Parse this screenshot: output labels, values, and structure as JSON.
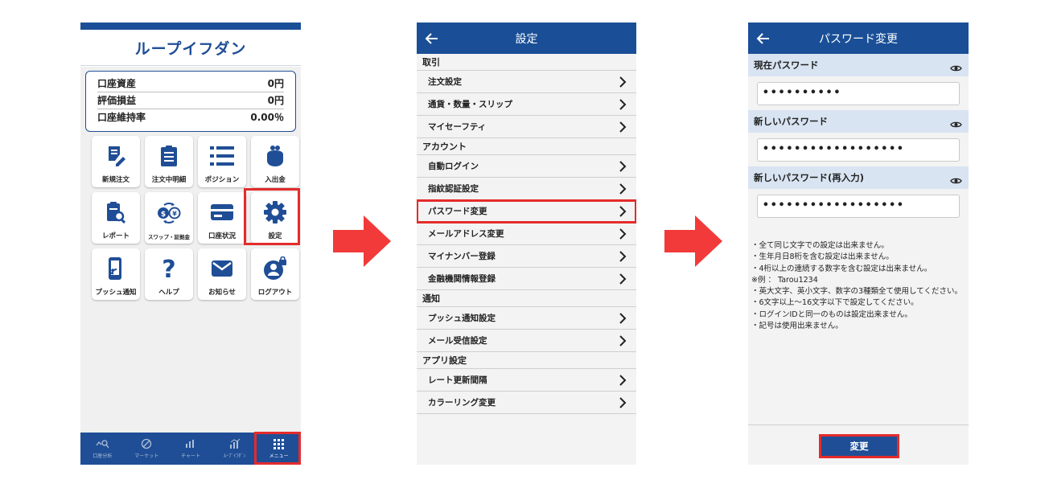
{
  "screen1": {
    "brand": "ループイフダン",
    "account": [
      {
        "label": "口座資産",
        "value": "0円"
      },
      {
        "label": "評価損益",
        "value": "0円"
      },
      {
        "label": "口座維持率",
        "value": "0.00％"
      }
    ],
    "tiles": [
      {
        "label": "新規注文",
        "icon": "new-order-icon"
      },
      {
        "label": "注文中明細",
        "icon": "order-details-icon"
      },
      {
        "label": "ポジション",
        "icon": "position-list-icon"
      },
      {
        "label": "入出金",
        "icon": "purse-icon"
      },
      {
        "label": "レポート",
        "icon": "report-icon"
      },
      {
        "label": "スワップ・証拠金",
        "icon": "swap-icon"
      },
      {
        "label": "口座状況",
        "icon": "card-icon"
      },
      {
        "label": "設定",
        "icon": "gear-icon"
      },
      {
        "label": "プッシュ通知",
        "icon": "phone-notify-icon"
      },
      {
        "label": "ヘルプ",
        "icon": "help-icon"
      },
      {
        "label": "お知らせ",
        "icon": "mail-icon"
      },
      {
        "label": "ログアウト",
        "icon": "logout-icon"
      }
    ],
    "tabs": [
      {
        "label": "口座分析",
        "icon": "analysis-icon"
      },
      {
        "label": "マーケット",
        "icon": "market-icon"
      },
      {
        "label": "チャート",
        "icon": "chart-icon"
      },
      {
        "label": "ﾙｰﾌﾟｲﾌﾀﾞﾝ",
        "icon": "loop-icon"
      },
      {
        "label": "メニュー",
        "icon": "grid-menu-icon"
      }
    ],
    "active_tab": "メニュー"
  },
  "screen2": {
    "title": "設定",
    "sections": [
      {
        "title": "取引",
        "items": [
          "注文設定",
          "通貨・数量・スリップ",
          "マイセーフティ"
        ]
      },
      {
        "title": "アカウント",
        "items": [
          "自動ログイン",
          "指紋認証設定",
          "パスワード変更",
          "メールアドレス変更",
          "マイナンバー登録",
          "金融機関情報登録"
        ]
      },
      {
        "title": "通知",
        "items": [
          "プッシュ通知設定",
          "メール受信設定"
        ]
      },
      {
        "title": "アプリ設定",
        "items": [
          "レート更新間隔",
          "カラーリング変更"
        ]
      }
    ],
    "highlighted_item": "パスワード変更"
  },
  "screen3": {
    "title": "パスワード変更",
    "fields": [
      {
        "label": "現在パスワード",
        "value": "••••••••••"
      },
      {
        "label": "新しいパスワード",
        "value": "••••••••••••••••••"
      },
      {
        "label": "新しいパスワード(再入力)",
        "value": "••••••••••••••••••"
      }
    ],
    "notes": [
      "・全て同じ文字での設定は出来ません。",
      "・生年月日8桁を含む設定は出来ません。",
      "・4桁以上の連続する数字を含む設定は出来ません。",
      "※例 ： Tarou1234",
      "・英大文字、英小文字、数字の3種類全て使用してください。",
      "・6文字以上〜16文字以下で設定してください。",
      "・ログインIDと同一のものは設定出来ません。",
      "・記号は使用出来ません。"
    ],
    "submit_label": "変更"
  },
  "colors": {
    "brand_blue": "#1f4e96",
    "highlight_red": "#e52b2b",
    "label_bg": "#d9e4f2"
  }
}
